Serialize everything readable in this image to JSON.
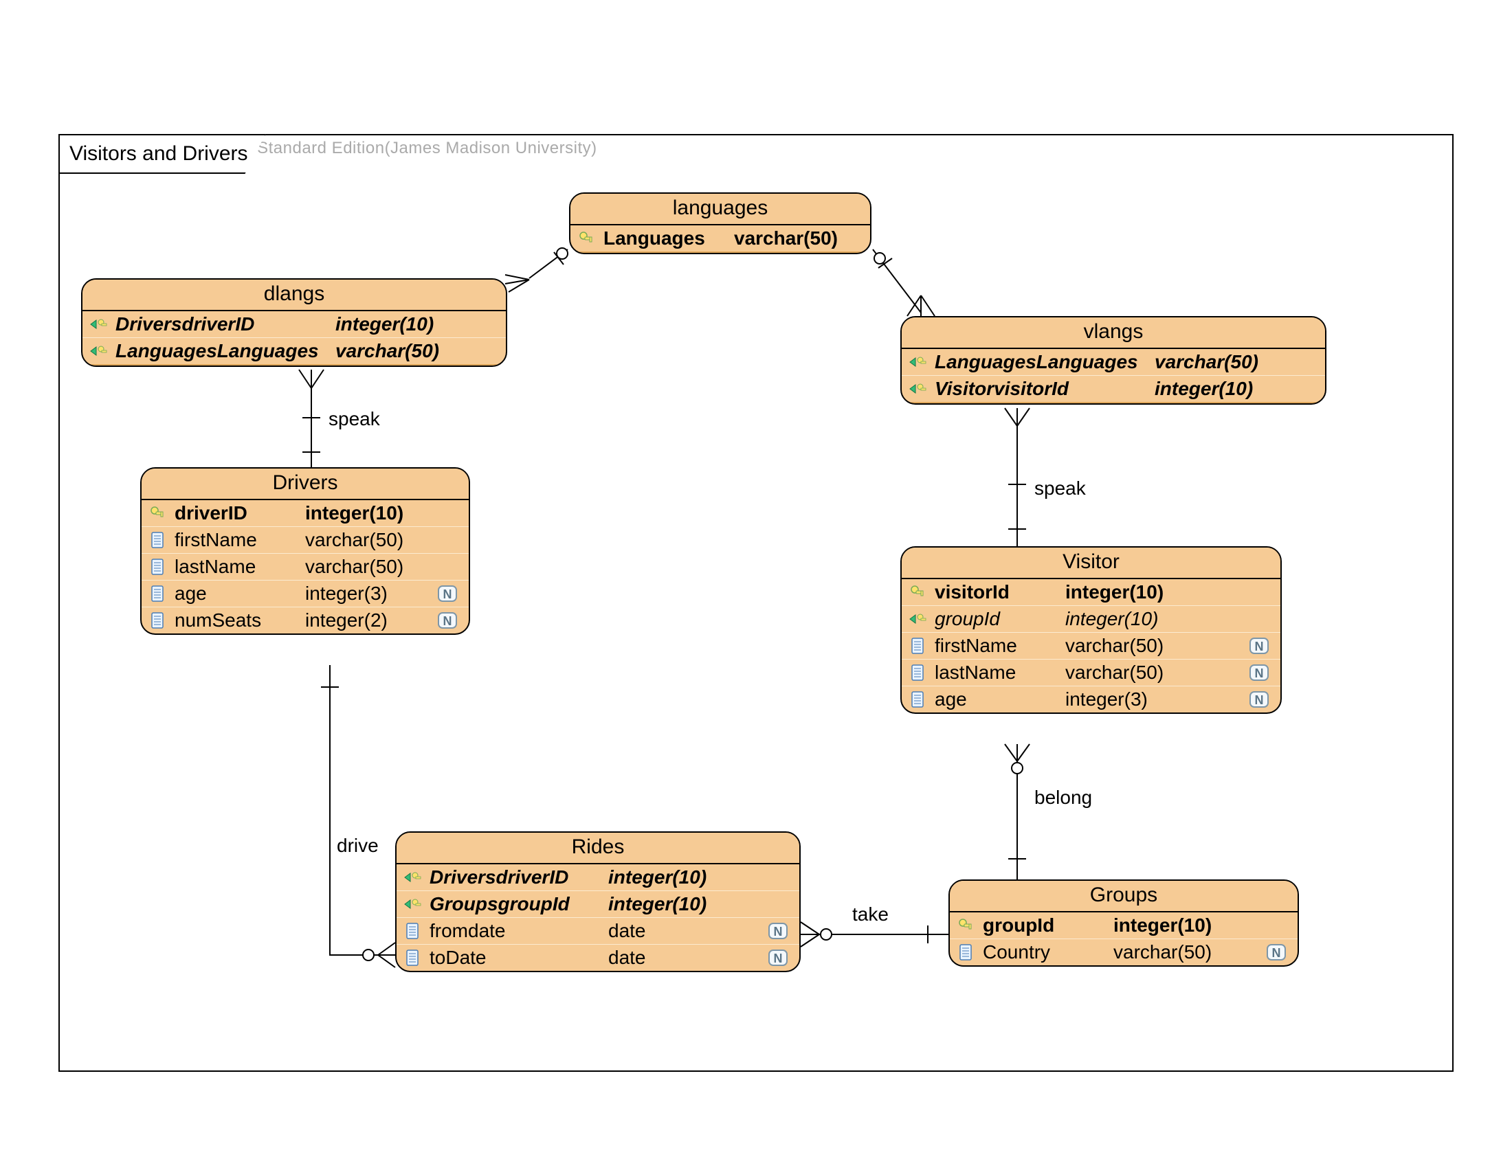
{
  "watermark": "Visual Paradigm for UML Standard Edition(James Madison University)",
  "frame_title": "Visitors and Drivers",
  "entities": {
    "languages": {
      "title": "languages",
      "attrs": [
        {
          "icon": "pk",
          "name": "Languages",
          "type": "varchar(50)",
          "bold": true
        }
      ]
    },
    "dlangs": {
      "title": "dlangs",
      "attrs": [
        {
          "icon": "fk",
          "name": "DriversdriverID",
          "type": "integer(10)",
          "bold": true,
          "italic": true
        },
        {
          "icon": "fk",
          "name": "LanguagesLanguages",
          "type": "varchar(50)",
          "bold": true,
          "italic": true
        }
      ]
    },
    "vlangs": {
      "title": "vlangs",
      "attrs": [
        {
          "icon": "fk",
          "name": "LanguagesLanguages",
          "type": "varchar(50)",
          "bold": true,
          "italic": true
        },
        {
          "icon": "fk",
          "name": "VisitorvisitorId",
          "type": "integer(10)",
          "bold": true,
          "italic": true
        }
      ]
    },
    "drivers": {
      "title": "Drivers",
      "attrs": [
        {
          "icon": "pk",
          "name": "driverID",
          "type": "integer(10)",
          "bold": true
        },
        {
          "icon": "col",
          "name": "firstName",
          "type": "varchar(50)"
        },
        {
          "icon": "col",
          "name": "lastName",
          "type": "varchar(50)"
        },
        {
          "icon": "col",
          "name": "age",
          "type": "integer(3)",
          "nullable": true
        },
        {
          "icon": "col",
          "name": "numSeats",
          "type": "integer(2)",
          "nullable": true
        }
      ]
    },
    "visitor": {
      "title": "Visitor",
      "attrs": [
        {
          "icon": "pk",
          "name": "visitorId",
          "type": "integer(10)",
          "bold": true
        },
        {
          "icon": "fk",
          "name": "groupId",
          "type": "integer(10)",
          "italic": true
        },
        {
          "icon": "col",
          "name": "firstName",
          "type": "varchar(50)",
          "nullable": true
        },
        {
          "icon": "col",
          "name": "lastName",
          "type": "varchar(50)",
          "nullable": true
        },
        {
          "icon": "col",
          "name": "age",
          "type": "integer(3)",
          "nullable": true
        }
      ]
    },
    "rides": {
      "title": "Rides",
      "attrs": [
        {
          "icon": "fk",
          "name": "DriversdriverID",
          "type": "integer(10)",
          "bold": true,
          "italic": true
        },
        {
          "icon": "fk",
          "name": "GroupsgroupId",
          "type": "integer(10)",
          "bold": true,
          "italic": true
        },
        {
          "icon": "col",
          "name": "fromdate",
          "type": "date",
          "nullable": true
        },
        {
          "icon": "col",
          "name": "toDate",
          "type": "date",
          "nullable": true
        }
      ]
    },
    "groups": {
      "title": "Groups",
      "attrs": [
        {
          "icon": "pk",
          "name": "groupId",
          "type": "integer(10)",
          "bold": true
        },
        {
          "icon": "col",
          "name": "Country",
          "type": "varchar(50)",
          "nullable": true
        }
      ]
    }
  },
  "relations": {
    "speak1": "speak",
    "speak2": "speak",
    "drive": "drive",
    "take": "take",
    "belong": "belong"
  }
}
